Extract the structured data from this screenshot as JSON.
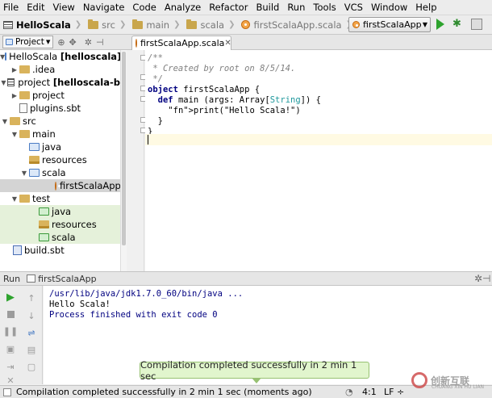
{
  "menu": [
    "File",
    "Edit",
    "View",
    "Navigate",
    "Code",
    "Analyze",
    "Refactor",
    "Build",
    "Run",
    "Tools",
    "VCS",
    "Window",
    "Help"
  ],
  "breadcrumb": [
    "HelloScala",
    "src",
    "main",
    "scala",
    "firstScalaApp.scala"
  ],
  "run_config": "firstScalaApp",
  "project_pane": {
    "tab": "Project"
  },
  "tree": [
    {
      "label": "HelloScala",
      "bold_suffix": "[helloscala]"
    },
    {
      "label": ".idea"
    },
    {
      "label": "project",
      "bold_suffix": "[helloscala-b"
    },
    {
      "label": "project"
    },
    {
      "label": "plugins.sbt"
    },
    {
      "label": "src"
    },
    {
      "label": "main"
    },
    {
      "label": "java"
    },
    {
      "label": "resources"
    },
    {
      "label": "scala"
    },
    {
      "label": "firstScalaApp"
    },
    {
      "label": "test"
    },
    {
      "label": "java"
    },
    {
      "label": "resources"
    },
    {
      "label": "scala"
    },
    {
      "label": "build.sbt"
    }
  ],
  "editor": {
    "tab": "firstScalaApp.scala",
    "code": [
      "/**",
      " * Created by root on 8/5/14.",
      " */",
      "object firstScalaApp {",
      "  def main (args: Array[String]) {",
      "    print(\"Hello Scala!\")",
      "  }",
      "}"
    ]
  },
  "run_panel": {
    "label": "Run",
    "tab": "firstScalaApp",
    "console": [
      "/usr/lib/java/jdk1.7.0_60/bin/java ...",
      "Hello Scala!",
      "Process finished with exit code 0"
    ]
  },
  "balloon": "Compilation completed successfully in 2 min 1 sec",
  "status": {
    "message": "Compilation completed successfully in 2 min 1 sec (moments ago)",
    "position": "4:1",
    "line_sep": "LF ÷"
  },
  "watermark": {
    "text": "创新互联",
    "sub": "CHUANG XIN HU LIAN"
  }
}
